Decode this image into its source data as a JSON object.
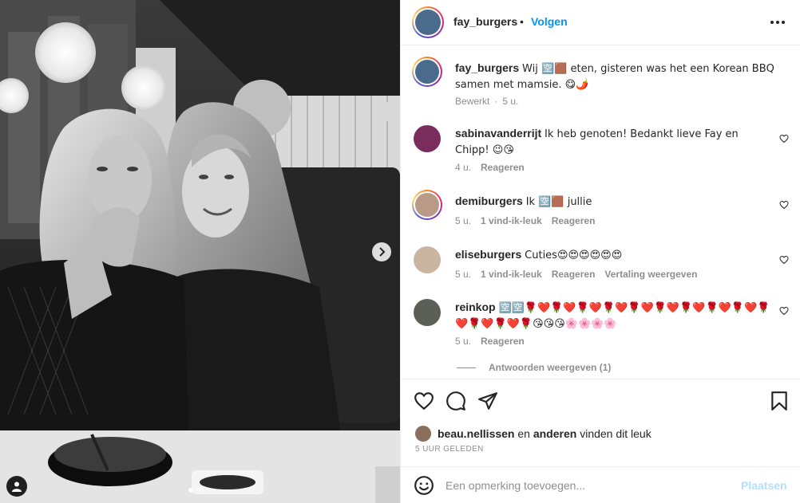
{
  "post": {
    "author": "fay_burgers",
    "separator": "•",
    "follow_label": "Volgen",
    "caption": "Wij 🈳🟫 eten, gisteren was het een Korean BBQ samen met mamsie. 😋🌶️",
    "edited_label": "Bewerkt",
    "caption_age": "5 u.",
    "avatar_color": "#4a6b8c"
  },
  "comments": [
    {
      "user": "sabinavanderrijt",
      "text": "Ik heb genoten! Bedankt lieve Fay en Chipp! 😉😘",
      "age": "4 u.",
      "likes": "",
      "reply_label": "Reageren",
      "translate_label": "",
      "avatar_color": "#7a2d5c",
      "avatar_ring": false
    },
    {
      "user": "demiburgers",
      "text": "Ik 🈳🟫 jullie",
      "age": "5 u.",
      "likes": "1 vind-ik-leuk",
      "reply_label": "Reageren",
      "translate_label": "",
      "avatar_color": "#b89a86",
      "avatar_ring": true
    },
    {
      "user": "eliseburgers",
      "text": "Cuties😍😍😍😍😍😍",
      "age": "5 u.",
      "likes": "1 vind-ik-leuk",
      "reply_label": "Reageren",
      "translate_label": "Vertaling weergeven",
      "avatar_color": "#c9b5a0",
      "avatar_ring": false
    },
    {
      "user": "reinkop",
      "text": "🈳🈳🌹❤️🌹❤️🌹❤️🌹❤️🌹❤️🌹❤️🌹❤️🌹❤️🌹❤️🌹❤️🌹❤️🌹❤️🌹😘😘😘🌸🌸🌸🌸",
      "age": "5 u.",
      "likes": "",
      "reply_label": "Reageren",
      "translate_label": "",
      "avatar_color": "#5b5f57",
      "avatar_ring": false
    }
  ],
  "replies_label": "Antwoorden weergeven (1)",
  "likes": {
    "liker": "beau.nellissen",
    "middle": "en",
    "others": "anderen",
    "suffix": "vinden dit leuk",
    "avatar_color": "#8a6f5c"
  },
  "timestamp": "5 UUR GELEDEN",
  "composer": {
    "placeholder": "Een opmerking toevoegen...",
    "post_label": "Plaatsen"
  },
  "carousel": {
    "total_slides": 2,
    "active_slide": 1
  },
  "icons": {
    "more": "more-horizontal-icon",
    "like": "heart-icon",
    "comment": "comment-icon",
    "share": "share-icon",
    "save": "bookmark-icon",
    "next": "chevron-right-icon",
    "tag": "user-tag-icon",
    "emoji": "emoji-icon"
  }
}
